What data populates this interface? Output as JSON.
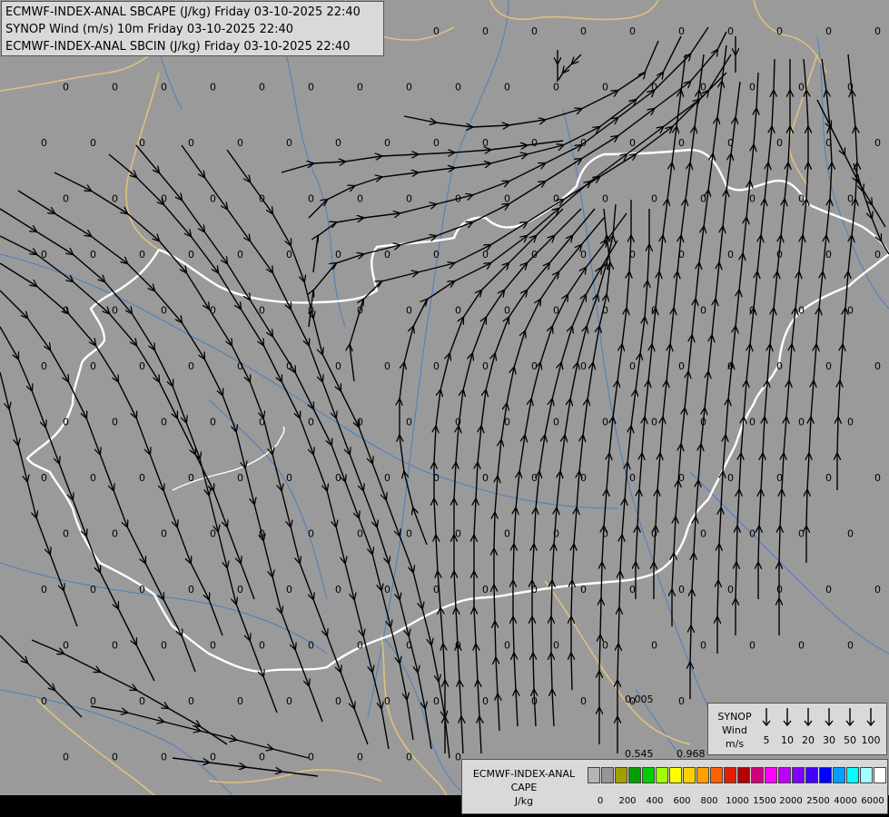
{
  "header": {
    "line1": "ECMWF-INDEX-ANAL SBCAPE (J/kg) Friday 03-10-2025 22:40",
    "line2": "SYNOP Wind (m/s) 10m Friday 03-10-2025 22:40",
    "line3": "ECMWF-INDEX-ANAL SBCIN (J/kg) Friday 03-10-2025 22:40"
  },
  "colors": {
    "background": "#9a9a9a",
    "border_yellow": "#e0c080",
    "border_white": "#ffffff",
    "rivers": "#4a7fc0",
    "streamlines": "#000000"
  },
  "map_values": {
    "default_value": "0",
    "special": [
      "0.005",
      "0.545",
      "0.968"
    ]
  },
  "synop_legend": {
    "title_line1": "SYNOP",
    "title_line2": "Wind",
    "title_line3": "m/s",
    "items": [
      "5",
      "10",
      "20",
      "30",
      "50",
      "100"
    ]
  },
  "cape_legend": {
    "title_line1": "ECMWF-INDEX-ANAL",
    "title_line2": "CAPE",
    "title_line3": "J/kg",
    "swatch_colors": [
      "#b4b4b4",
      "#969696",
      "#a0a000",
      "#00a000",
      "#00d000",
      "#a0ff00",
      "#ffff00",
      "#ffd000",
      "#ffa000",
      "#ff6000",
      "#e02000",
      "#b00000",
      "#d00080",
      "#ff00ff",
      "#c000ff",
      "#8000ff",
      "#4000ff",
      "#0000ff",
      "#00a0ff",
      "#00ffff",
      "#a0ffff",
      "#ffffff"
    ],
    "tick_labels": [
      "0",
      "200",
      "400",
      "600",
      "800",
      "1000",
      "1500",
      "2000",
      "2500",
      "4000",
      "6000"
    ]
  }
}
